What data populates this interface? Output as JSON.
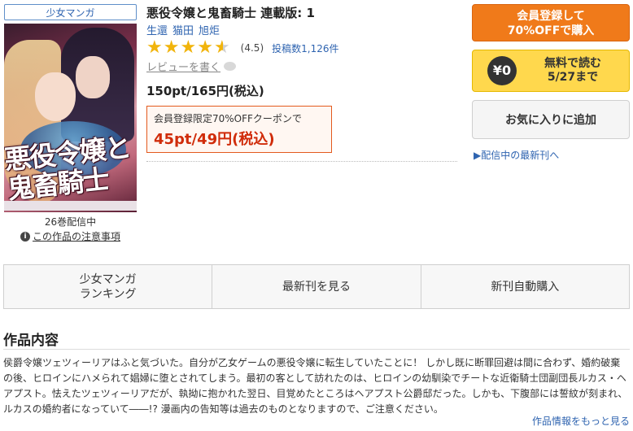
{
  "genre_tag": "少女マンガ",
  "cover": {
    "title_art": "悪役令嬢と鬼畜騎士"
  },
  "volume_count": "26巻配信中",
  "notice_label": "この作品の注意事項",
  "book": {
    "title": "悪役令嬢と鬼畜騎士 連載版: 1",
    "authors": [
      "生還",
      "猫田",
      "旭炬"
    ],
    "rating_value": 4.5,
    "rating_text": "(4.5)",
    "review_count": "投稿数1,126件",
    "write_review": "レビューを書く",
    "price": "150pt/165円(税込)",
    "coupon_text": "会員登録限定70%OFFクーポンで",
    "coupon_price": "45pt/49円(税込)"
  },
  "buttons": {
    "signup_line1": "会員登録して",
    "signup_line2": "70%OFFで購入",
    "free_icon": "¥0",
    "free_line1": "無料で読む",
    "free_line2": "5/27まで",
    "favorite": "お気に入りに追加",
    "latest_link": "▶配信中の最新刊へ"
  },
  "nav": [
    {
      "line1": "少女マンガ",
      "line2": "ランキング"
    },
    {
      "line1": "最新刊を見る",
      "line2": ""
    },
    {
      "line1": "新刊自動購入",
      "line2": ""
    }
  ],
  "section_title": "作品内容",
  "description": "侯爵令嬢ツェツィーリアはふと気づいた。自分が乙女ゲームの悪役令嬢に転生していたことに！ しかし既に断罪回避は間に合わず、婚約破棄の後、ヒロインにハメられて娼婦に堕とされてしまう。最初の客として訪れたのは、ヒロインの幼馴染でチートな近衛騎士団副団長ルカス・ヘアプスト。怯えたツェツィーリアだが、執拗に抱かれた翌日、目覚めたところはヘアプスト公爵邸だった。しかも、下腹部には誓紋が刻まれ、ルカスの婚約者になっていて――!? 漫画内の告知等は過去のものとなりますので、ご注意ください。",
  "more_link": "作品情報をもっと見る",
  "colors": {
    "accent_orange": "#f07a1a",
    "free_yellow": "#ffd84d",
    "link_blue": "#2f64b0",
    "coupon_red": "#d02c0a",
    "star": "#f1b40c"
  }
}
